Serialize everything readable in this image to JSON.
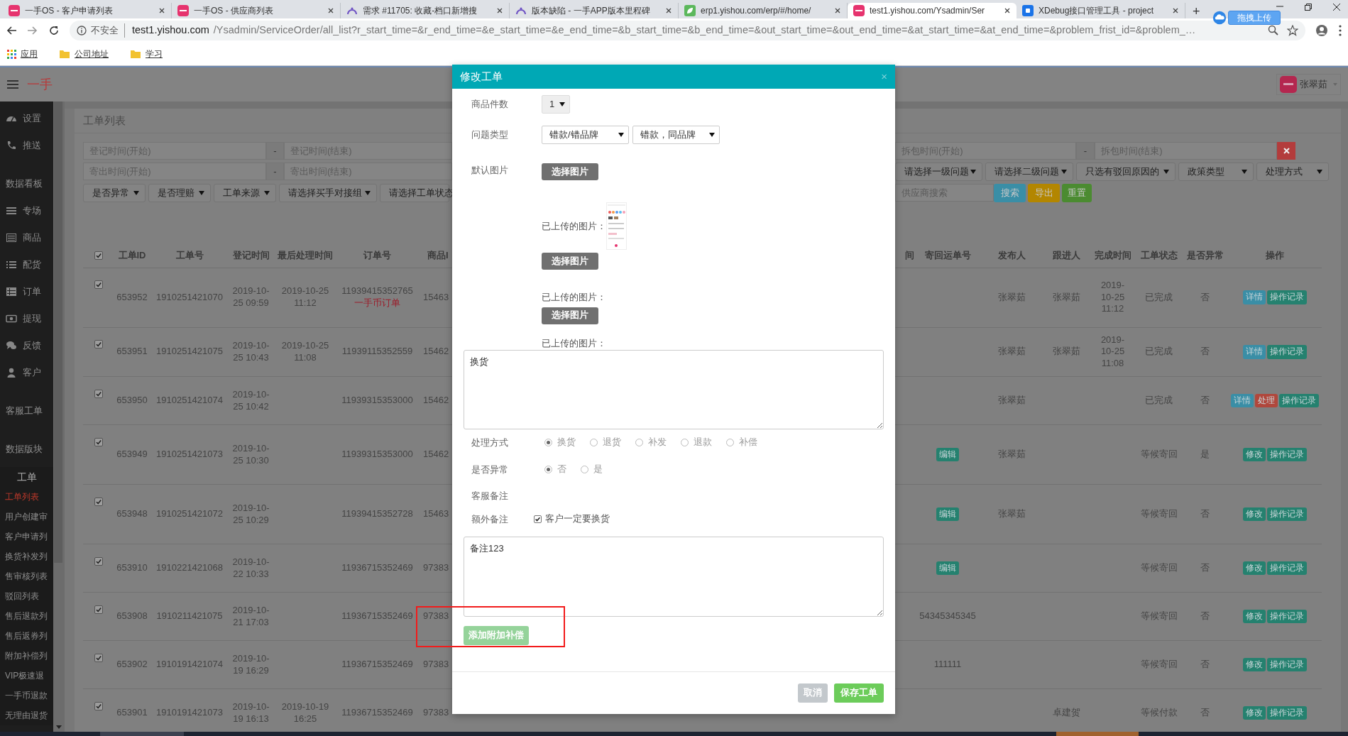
{
  "browser": {
    "tabs": [
      {
        "title": "一手OS - 客户申请列表",
        "selected": false
      },
      {
        "title": "一手OS - 供应商列表",
        "selected": false
      },
      {
        "title": "需求 #11705: 收藏-档口新增搜",
        "selected": false
      },
      {
        "title": "版本缺陷 - 一手APP版本里程碑",
        "selected": false
      },
      {
        "title": "erp1.yishou.com/erp/#/home/",
        "selected": false
      },
      {
        "title": "test1.yishou.com/Ysadmin/Ser",
        "selected": true
      },
      {
        "title": "XDebug接口管理工具 - project",
        "selected": false
      }
    ],
    "new_tab": "+",
    "address": {
      "security": "不安全",
      "host": "test1.yishou.com",
      "path": "/Ysadmin/ServiceOrder/all_list?r_start_time=&r_end_time=&e_start_time=&e_end_time=&b_start_time=&b_end_time=&out_start_time=&out_end_time=&at_start_time=&at_end_time=&problem_frist_id=&problem_…"
    },
    "bookmarks": [
      {
        "kind": "apps",
        "label": "应用"
      },
      {
        "kind": "folder",
        "label": "公司地址"
      },
      {
        "kind": "folder",
        "label": "学习"
      }
    ],
    "upload_button": "拖拽上传"
  },
  "app": {
    "logo": "一手",
    "user": "张翠茹"
  },
  "sidebar": {
    "items": [
      {
        "kind": "item",
        "label": "设置"
      },
      {
        "kind": "item",
        "label": "推送"
      },
      {
        "kind": "section",
        "label": "数据看板"
      },
      {
        "kind": "item",
        "label": "专场"
      },
      {
        "kind": "item",
        "label": "商品"
      },
      {
        "kind": "item",
        "label": "配货"
      },
      {
        "kind": "item",
        "label": "订单"
      },
      {
        "kind": "item",
        "label": "提现"
      },
      {
        "kind": "item",
        "label": "反馈"
      },
      {
        "kind": "item",
        "label": "客户"
      },
      {
        "kind": "section",
        "label": "客服工单"
      },
      {
        "kind": "section",
        "label": "数据版块"
      },
      {
        "kind": "group",
        "label": "工单",
        "children": [
          {
            "label": "工单列表",
            "selected": true
          },
          {
            "label": "用户创建审",
            "selected": false
          },
          {
            "label": "客户申请列",
            "selected": false
          },
          {
            "label": "换货补发列",
            "selected": false
          },
          {
            "label": "售审核列表",
            "selected": false
          },
          {
            "label": "驳回列表",
            "selected": false
          },
          {
            "label": "售后退款列",
            "selected": false
          },
          {
            "label": "售后返券列",
            "selected": false
          },
          {
            "label": "附加补偿列",
            "selected": false
          },
          {
            "label": "VIP极速退",
            "selected": false
          },
          {
            "label": "一手币退款",
            "selected": false
          },
          {
            "label": "无理由退货",
            "selected": false
          }
        ]
      }
    ]
  },
  "panel": {
    "title": "工单列表"
  },
  "filters": {
    "rows": [
      {
        "left": [
          {
            "kind": "input",
            "placeholder": "登记时间(开始)"
          },
          {
            "kind": "addon",
            "text": "-"
          },
          {
            "kind": "input",
            "placeholder": "登记时间(结束)"
          }
        ],
        "right": [
          {
            "kind": "input",
            "placeholder": "拆包时间(开始)"
          },
          {
            "kind": "addon",
            "text": "-"
          },
          {
            "kind": "input",
            "placeholder": "拆包时间(结束)"
          },
          {
            "kind": "clear"
          }
        ]
      },
      {
        "left": [
          {
            "kind": "input",
            "placeholder": "寄出时间(开始)"
          },
          {
            "kind": "addon",
            "text": "-"
          },
          {
            "kind": "input",
            "placeholder": "寄出时间(结束)"
          }
        ],
        "right": [
          {
            "kind": "select",
            "text": "请选择一级问题"
          },
          {
            "kind": "select",
            "text": "请选择二级问题"
          },
          {
            "kind": "select",
            "text": "只选有驳回原因的"
          },
          {
            "kind": "select",
            "text": "政策类型"
          },
          {
            "kind": "select",
            "text": "处理方式"
          }
        ]
      },
      {
        "left": [
          {
            "kind": "select",
            "text": "是否异常"
          },
          {
            "kind": "select",
            "text": "是否理赔"
          },
          {
            "kind": "select",
            "text": "工单来源"
          },
          {
            "kind": "select",
            "text": "请选择买手对接组"
          },
          {
            "kind": "select",
            "text": "请选择工单状态"
          }
        ],
        "right": [
          {
            "kind": "input",
            "placeholder": "供应商搜索"
          },
          {
            "kind": "button",
            "text": "搜索"
          },
          {
            "kind": "button",
            "text": "导出"
          },
          {
            "kind": "button",
            "text": "重置"
          }
        ]
      }
    ]
  },
  "table": {
    "select_all_checked": true,
    "columns": [
      "工单ID",
      "工单号",
      "登记时间",
      "最后处理时间",
      "订单号",
      "商品I",
      "间",
      "寄回运单号",
      "发布人",
      "跟进人",
      "完成时间",
      "工单状态",
      "是否异常",
      "操作"
    ],
    "rows": [
      {
        "checked": true,
        "id": "653952",
        "number": "1910251421070",
        "registered": "2019-10-25 09:59",
        "last_processed": "2019-10-25 11:12",
        "order": "11939415352765",
        "order_note": "一手币订单",
        "goods": "15463",
        "publisher": "张翠茹",
        "follower": "张翠茹",
        "completed": "2019-10-25 11:12",
        "status": "已完成",
        "abnormal": "否",
        "actions": [
          {
            "label": "详情",
            "kind": "detail"
          },
          {
            "label": "操作记录",
            "kind": "log"
          }
        ]
      },
      {
        "checked": true,
        "id": "653951",
        "number": "1910251421075",
        "registered": "2019-10-25 10:43",
        "last_processed": "2019-10-25 11:08",
        "order": "11939115352559",
        "goods": "15462",
        "publisher": "张翠茹",
        "follower": "张翠茹",
        "completed": "2019-10-25 11:08",
        "status": "已完成",
        "abnormal": "否",
        "actions": [
          {
            "label": "详情",
            "kind": "detail"
          },
          {
            "label": "操作记录",
            "kind": "log"
          }
        ]
      },
      {
        "checked": true,
        "id": "653950",
        "number": "1910251421074",
        "registered": "2019-10-25 10:42",
        "order": "11939315353000",
        "goods": "15462",
        "publisher": "张翠茹",
        "status": "已完成",
        "abnormal": "否",
        "actions": [
          {
            "label": "详情",
            "kind": "detail"
          },
          {
            "label": "处理",
            "kind": "handle"
          },
          {
            "label": "操作记录",
            "kind": "log"
          }
        ]
      },
      {
        "checked": true,
        "id": "653949",
        "number": "1910251421073",
        "registered": "2019-10-25 10:30",
        "order": "11939315353000",
        "goods": "15462",
        "return_button": "编辑",
        "publisher": "张翠茹",
        "status": "等候寄回",
        "abnormal": "是",
        "actions": [
          {
            "label": "修改",
            "kind": "modify"
          },
          {
            "label": "操作记录",
            "kind": "log"
          }
        ]
      },
      {
        "checked": true,
        "id": "653948",
        "number": "1910251421072",
        "registered": "2019-10-25 10:29",
        "order": "11939415352728",
        "goods": "15463",
        "return_button": "编辑",
        "publisher": "张翠茹",
        "status": "等候寄回",
        "abnormal": "否",
        "actions": [
          {
            "label": "修改",
            "kind": "modify"
          },
          {
            "label": "操作记录",
            "kind": "log"
          }
        ]
      },
      {
        "checked": true,
        "id": "653910",
        "number": "1910221421068",
        "registered": "2019-10-22 10:33",
        "order": "11936715352469",
        "goods": "97383",
        "return_button": "编辑",
        "status": "等候寄回",
        "abnormal": "否",
        "actions": [
          {
            "label": "修改",
            "kind": "modify"
          },
          {
            "label": "操作记录",
            "kind": "log"
          }
        ]
      },
      {
        "checked": true,
        "id": "653908",
        "number": "1910211421075",
        "registered": "2019-10-21 17:03",
        "order": "11936715352469",
        "goods": "97383",
        "return_waybill": "54345345345",
        "status": "等候寄回",
        "abnormal": "否",
        "actions": [
          {
            "label": "修改",
            "kind": "modify"
          },
          {
            "label": "操作记录",
            "kind": "log"
          }
        ]
      },
      {
        "checked": true,
        "id": "653902",
        "number": "1910191421074",
        "registered": "2019-10-19 16:29",
        "order": "11936715352469",
        "goods": "97383",
        "return_waybill": "111111",
        "status": "等候寄回",
        "abnormal": "否",
        "actions": [
          {
            "label": "修改",
            "kind": "modify"
          },
          {
            "label": "操作记录",
            "kind": "log"
          }
        ]
      },
      {
        "checked": true,
        "id": "653901",
        "number": "1910191421073",
        "registered": "2019-10-19 16:13",
        "last_processed": "2019-10-19 16:25",
        "order": "11936715352469",
        "goods": "97383",
        "follower": "卓建贺",
        "status": "等候付款",
        "abnormal": "否",
        "actions": [
          {
            "label": "修改",
            "kind": "modify"
          },
          {
            "label": "操作记录",
            "kind": "log"
          }
        ]
      }
    ]
  },
  "modal": {
    "title": "修改工单",
    "close": "×",
    "quantity": {
      "label": "商品件数",
      "value": "1"
    },
    "problem_type": {
      "label": "问题类型",
      "values": [
        "错款/错品牌",
        "错款，同品牌"
      ]
    },
    "images": {
      "label": "默认图片",
      "groups": [
        {
          "button": "选择图片",
          "uploaded_label": "已上传的图片："
        },
        {
          "button": "选择图片",
          "uploaded_label": "已上传的图片："
        },
        {
          "button": "选择图片",
          "uploaded_label": "已上传的图片："
        }
      ]
    },
    "description": "换货",
    "handling": {
      "label": "处理方式",
      "options": [
        {
          "label": "换货",
          "selected": true
        },
        {
          "label": "退货",
          "selected": false
        },
        {
          "label": "补发",
          "selected": false
        },
        {
          "label": "退款",
          "selected": false
        },
        {
          "label": "补偿",
          "selected": false
        }
      ]
    },
    "abnormal": {
      "label": "是否异常",
      "options": [
        {
          "label": "否",
          "selected": true
        },
        {
          "label": "是",
          "selected": false
        }
      ]
    },
    "service_note": {
      "label": "客服备注"
    },
    "extra_note": {
      "label": "额外备注",
      "checkbox_label": "客户一定要换货",
      "checked": true
    },
    "remark": "备注123",
    "extra_button": {
      "label": "添加附加补偿",
      "highlighted": true
    },
    "cancel": "取消",
    "save": "保存工单"
  }
}
